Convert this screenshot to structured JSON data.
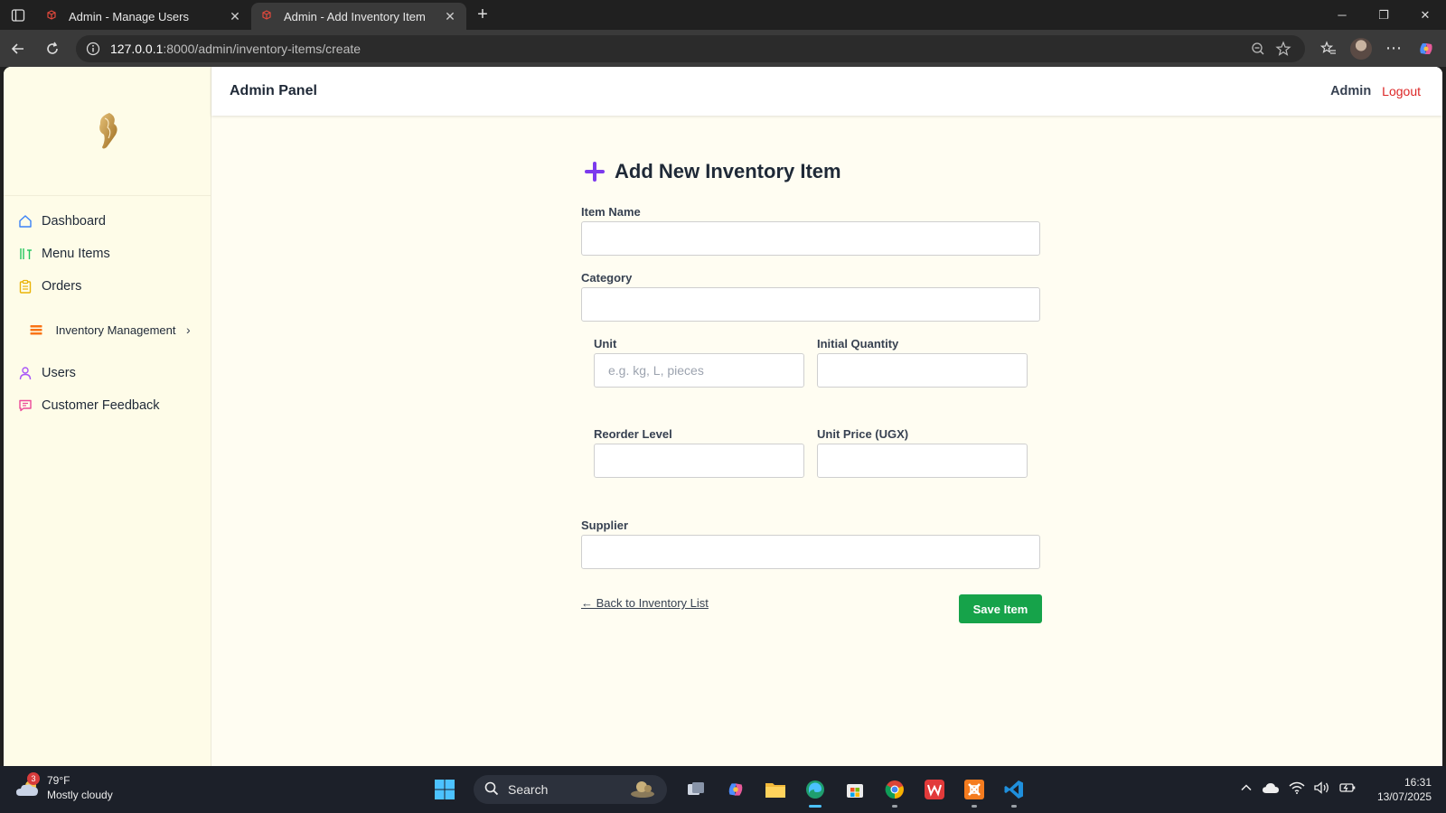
{
  "browser": {
    "tabs": [
      {
        "title": "Admin - Manage Users",
        "active": false
      },
      {
        "title": "Admin - Add Inventory Item",
        "active": true
      }
    ],
    "url_host": "127.0.0.1",
    "url_rest": ":8000/admin/inventory-items/create"
  },
  "sidebar": {
    "items": [
      {
        "label": "Dashboard",
        "icon": "home-icon",
        "color": "#3b82f6"
      },
      {
        "label": "Menu Items",
        "icon": "utensils-icon",
        "color": "#22c55e"
      },
      {
        "label": "Orders",
        "icon": "clipboard-icon",
        "color": "#eab308"
      },
      {
        "label": "Inventory Management",
        "icon": "layers-icon",
        "color": "#f97316"
      },
      {
        "label": "Users",
        "icon": "user-icon",
        "color": "#a855f7"
      },
      {
        "label": "Customer Feedback",
        "icon": "message-icon",
        "color": "#ec4899"
      }
    ]
  },
  "topbar": {
    "brand": "Admin Panel",
    "user": "Admin",
    "logout": "Logout"
  },
  "form": {
    "title": "Add New Inventory Item",
    "item_name": {
      "label": "Item Name",
      "value": ""
    },
    "category": {
      "label": "Category",
      "value": ""
    },
    "unit": {
      "label": "Unit",
      "value": "",
      "placeholder": "e.g. kg, L, pieces"
    },
    "initial_quantity": {
      "label": "Initial Quantity",
      "value": ""
    },
    "reorder_level": {
      "label": "Reorder Level",
      "value": ""
    },
    "unit_price": {
      "label": "Unit Price (UGX)",
      "value": ""
    },
    "supplier": {
      "label": "Supplier",
      "value": ""
    },
    "back_link": "← Back to Inventory List",
    "save_button": "Save Item"
  },
  "taskbar": {
    "weather_temp": "79°F",
    "weather_desc": "Mostly cloudy",
    "weather_badge": "3",
    "search_label": "Search",
    "time": "16:31",
    "date": "13/07/2025"
  },
  "colors": {
    "accent_purple": "#7c3aed",
    "save_green": "#16a34a",
    "logout_red": "#dc2626",
    "sidebar_bg": "#fefce8",
    "page_bg": "#fffdf2"
  }
}
